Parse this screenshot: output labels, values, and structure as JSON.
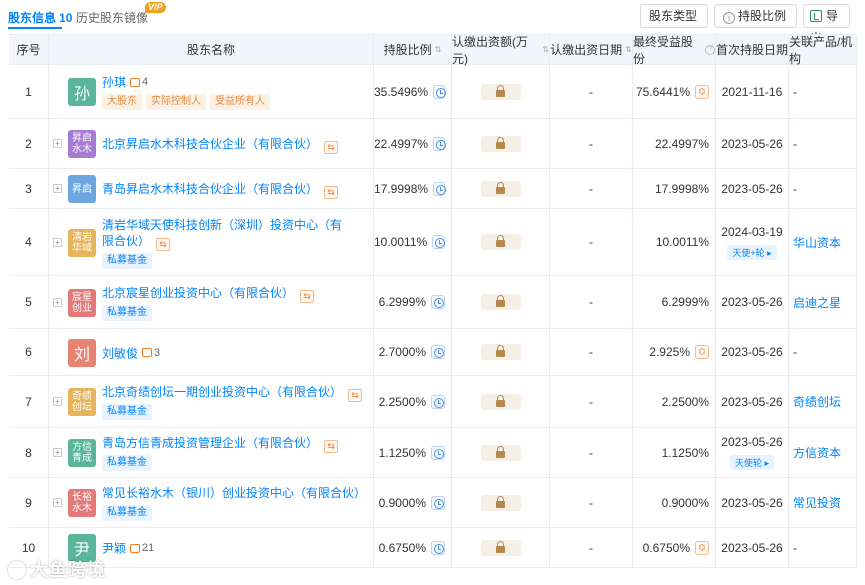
{
  "tabs": {
    "active_label": "股东信息",
    "active_count": "10",
    "history_label": "历史股东镜像",
    "history_badge": "VIP"
  },
  "toolbar": {
    "type_label": "股东类型",
    "ratio_label": "持股比例",
    "export_label": "导出"
  },
  "columns": [
    "序号",
    "股东名称",
    "持股比例",
    "认缴出资额(万元)",
    "认缴出资日期",
    "最终受益股份",
    "首次持股日期",
    "关联产品/机构"
  ],
  "colors": {
    "link": "#0084ff",
    "header_bg": "#f2f6fb"
  },
  "rows": [
    {
      "idx": "1",
      "avatar": "孙",
      "avatar_color": "#5ab59b",
      "name": "孙琪",
      "people": "4",
      "tags": [
        "大股东",
        "实际控制人",
        "受益所有人"
      ],
      "ratio": "35.5496%",
      "date": "-",
      "benefit": "75.6441%",
      "first": "2021-11-16",
      "round": "",
      "rel": "-"
    },
    {
      "idx": "2",
      "avatar": "昇启水木",
      "avatar_color": "#a77ad6",
      "name": "北京昇启水木科技合伙企业（有限合伙）",
      "tags": [],
      "ratio": "22.4997%",
      "date": "-",
      "benefit": "22.4997%",
      "first": "2023-05-26",
      "round": "",
      "rel": "-"
    },
    {
      "idx": "3",
      "avatar": "昇启",
      "avatar_color": "#6ea6e0",
      "name": "青岛昇启水木科技合伙企业（有限合伙）",
      "tags": [],
      "ratio": "17.9998%",
      "date": "-",
      "benefit": "17.9998%",
      "first": "2023-05-26",
      "round": "",
      "rel": "-"
    },
    {
      "idx": "4",
      "avatar": "清岩华域",
      "avatar_color": "#e6b45a",
      "name": "清岩华域天使科技创新（深圳）投资中心（有限合伙）",
      "tags": [
        "私募基金"
      ],
      "ratio": "10.0011%",
      "date": "-",
      "benefit": "10.0011%",
      "first": "2024-03-19",
      "round": "天使+轮 ▸",
      "rel": "华山资本"
    },
    {
      "idx": "5",
      "avatar": "宸星创业",
      "avatar_color": "#e27a7a",
      "name": "北京宸星创业投资中心（有限合伙）",
      "tags": [
        "私募基金"
      ],
      "ratio": "6.2999%",
      "date": "-",
      "benefit": "6.2999%",
      "first": "2023-05-26",
      "round": "",
      "rel": "启迪之星"
    },
    {
      "idx": "6",
      "avatar": "刘",
      "avatar_color": "#e88373",
      "name": "刘敏俊",
      "people": "3",
      "tags": [],
      "ratio": "2.7000%",
      "date": "-",
      "benefit": "2.925%",
      "first": "2023-05-26",
      "round": "",
      "rel": "-"
    },
    {
      "idx": "7",
      "avatar": "奇绩创坛",
      "avatar_color": "#e6b45a",
      "name": "北京奇绩创坛一期创业投资中心（有限合伙）",
      "tags": [
        "私募基金"
      ],
      "ratio": "2.2500%",
      "date": "-",
      "benefit": "2.2500%",
      "first": "2023-05-26",
      "round": "",
      "rel": "奇绩创坛"
    },
    {
      "idx": "8",
      "avatar": "方信青成",
      "avatar_color": "#5ab59b",
      "name": "青岛方信青成投资管理企业（有限合伙）",
      "tags": [
        "私募基金"
      ],
      "ratio": "1.1250%",
      "date": "-",
      "benefit": "1.1250%",
      "first": "2023-05-26",
      "round": "天使轮 ▸",
      "rel": "方信资本"
    },
    {
      "idx": "9",
      "avatar": "长裕水木",
      "avatar_color": "#e27a7a",
      "name": "常见长裕水木（银川）创业投资中心（有限合伙）",
      "tags": [
        "私募基金"
      ],
      "ratio": "0.9000%",
      "date": "-",
      "benefit": "0.9000%",
      "first": "2023-05-26",
      "round": "",
      "rel": "常见投资"
    },
    {
      "idx": "10",
      "avatar": "尹",
      "avatar_color": "#5ab59b",
      "name": "尹颖",
      "people": "21",
      "tags": [],
      "ratio": "0.6750%",
      "date": "-",
      "benefit": "0.6750%",
      "first": "2023-05-26",
      "round": "",
      "rel": "-"
    }
  ],
  "watermark": "大鱼跨境"
}
